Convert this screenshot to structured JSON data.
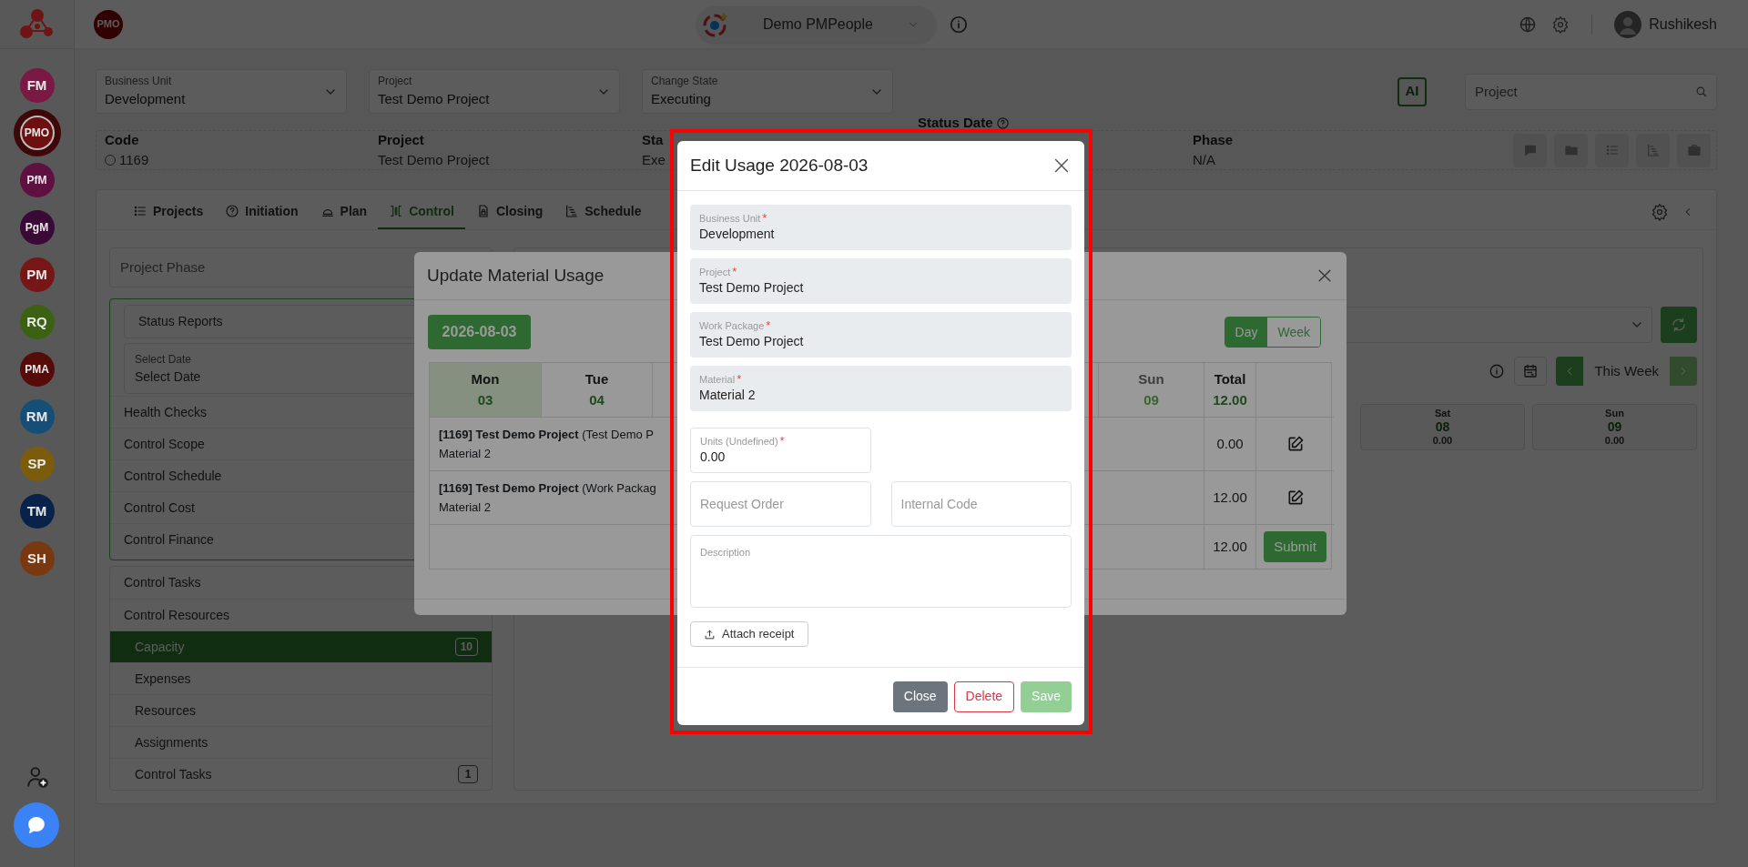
{
  "rail": {
    "items": [
      {
        "label": "FM",
        "color": "#7a1a44",
        "selected": false
      },
      {
        "label": "PMO",
        "color": "#6e1010",
        "selected": true
      },
      {
        "label": "PfM",
        "color": "#5e1040",
        "selected": false
      },
      {
        "label": "PgM",
        "color": "#3a0a36",
        "selected": false
      },
      {
        "label": "PM",
        "color": "#761616",
        "selected": false
      },
      {
        "label": "RQ",
        "color": "#3a6212",
        "selected": false
      },
      {
        "label": "PMA",
        "color": "#560b0b",
        "selected": false
      },
      {
        "label": "RM",
        "color": "#154f78",
        "selected": false
      },
      {
        "label": "SP",
        "color": "#7a5c0c",
        "selected": false
      },
      {
        "label": "TM",
        "color": "#08224a",
        "selected": false
      },
      {
        "label": "SH",
        "color": "#7a3810",
        "selected": false
      }
    ]
  },
  "topbar": {
    "module_badge": "PMO",
    "organization": "Demo PMPeople",
    "user": "Rushikesh"
  },
  "filters": [
    {
      "label": "Business Unit",
      "value": "Development"
    },
    {
      "label": "Project",
      "value": "Test Demo Project"
    },
    {
      "label": "Change State",
      "value": "Executing"
    }
  ],
  "ai_button": "AI",
  "search": {
    "placeholder": "Project"
  },
  "summary": [
    {
      "label": "Code",
      "value": "1169"
    },
    {
      "label": "Project",
      "value": "Test Demo Project"
    },
    {
      "label": "Sta",
      "value": "Exe"
    },
    {
      "label": "Status Date"
    },
    {
      "label": "Phase",
      "value": "N/A"
    }
  ],
  "tabs": [
    {
      "label": "Projects",
      "selected": false
    },
    {
      "label": "Initiation",
      "selected": false
    },
    {
      "label": "Plan",
      "selected": false
    },
    {
      "label": "Control",
      "selected": true
    },
    {
      "label": "Closing",
      "selected": false
    },
    {
      "label": "Schedule",
      "selected": false
    }
  ],
  "left_panel": {
    "phase_placeholder": "Project Phase",
    "report_select": "Status Reports",
    "date_field": {
      "label": "Select Date",
      "value": "Select Date"
    },
    "control_items": [
      "Health Checks",
      "Control Scope",
      "Control Schedule",
      "Control Cost",
      "Control Finance"
    ],
    "menu": [
      {
        "label": "Control Tasks"
      },
      {
        "label": "Control Resources",
        "children": [
          {
            "label": "Capacity",
            "badge": "10",
            "selected": true
          },
          {
            "label": "Expenses",
            "selected": false
          },
          {
            "label": "Resources",
            "selected": false
          },
          {
            "label": "Assignments",
            "selected": false
          },
          {
            "label": "Control Tasks",
            "badge": "1",
            "selected": false
          }
        ]
      }
    ]
  },
  "right_panel": {
    "week_label": "This Week",
    "days": [
      {
        "day": "Sat",
        "date": "08",
        "value": "0.00"
      },
      {
        "day": "Sun",
        "date": "09",
        "value": "0.00"
      }
    ]
  },
  "material_modal": {
    "title": "Update Material Usage",
    "date_button": "2026-08-03",
    "view_toggle": [
      {
        "label": "Day",
        "selected": true
      },
      {
        "label": "Week",
        "selected": false
      }
    ],
    "columns": [
      {
        "day": "Mon",
        "date": "03",
        "selected": true,
        "weekend": false
      },
      {
        "day": "Tue",
        "date": "04",
        "selected": false,
        "weekend": false
      },
      {
        "day": "Sun",
        "date": "09",
        "selected": false,
        "weekend": true
      }
    ],
    "total_header": {
      "label": "Total",
      "value": "12.00"
    },
    "rows": [
      {
        "text": "**[1169] Test Demo Project** (Test Demo P",
        "material": "Material 2",
        "total": "0.00"
      },
      {
        "text": "**[1169] Test Demo Project** (Work Packag",
        "material": "Material 2",
        "total": "12.00"
      }
    ],
    "footer_total": "12.00",
    "submit": "Submit"
  },
  "edit_modal": {
    "title": "Edit Usage 2026-08-03",
    "rows": [
      [
        {
          "kind": "locked",
          "label": "Business Unit",
          "value": "Development",
          "required_mark": "*"
        }
      ],
      [
        {
          "kind": "locked",
          "label": "Project",
          "value": "Test Demo Project",
          "required_mark": "*"
        }
      ],
      [
        {
          "kind": "locked",
          "label": "Work Package",
          "value": "Test Demo Project",
          "required_mark": "*"
        }
      ],
      [
        {
          "kind": "locked",
          "label": "Material",
          "value": "Material 2",
          "required_mark": "*"
        }
      ],
      [
        {
          "kind": "input",
          "label": "Units (Undefined)",
          "value": "0.00",
          "required_mark": "*"
        }
      ],
      [
        {
          "kind": "input",
          "placeholder": "Request Order"
        },
        {
          "kind": "input",
          "placeholder": "Internal Code"
        }
      ],
      [
        {
          "kind": "textarea",
          "label": "Description"
        }
      ]
    ],
    "attach": "Attach receipt",
    "buttons": [
      {
        "label": "Close",
        "kind": "secondary",
        "disabled": false
      },
      {
        "label": "Delete",
        "kind": "danger",
        "disabled": false
      },
      {
        "label": "Save",
        "kind": "primary",
        "disabled": true
      }
    ]
  }
}
